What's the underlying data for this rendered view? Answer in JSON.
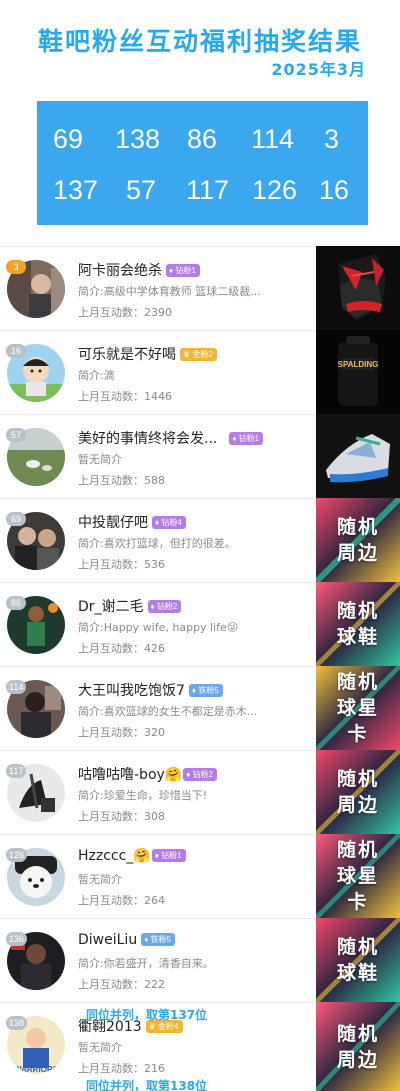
{
  "header": {
    "title": "鞋吧粉丝互动福利抽奖结果",
    "date": "2025年3月"
  },
  "winning_numbers": {
    "row1": [
      "69",
      "138",
      "86",
      "114",
      "3"
    ],
    "row2": [
      "137",
      "57",
      "117",
      "126",
      "16"
    ]
  },
  "colors": {
    "accent": "#28a9ee",
    "number_box": "#3aa7ef",
    "badge_diamond": "#b27de8",
    "badge_gold": "#f3b52f",
    "badge_iron": "#6aa7ee"
  },
  "labels": {
    "interaction_prefix": "上月互动数：",
    "bio_prefix": "简介:"
  },
  "entries": [
    {
      "rank": "3",
      "rank_style": "gold",
      "name": "阿卡丽会绝杀",
      "badge": "钻粉1",
      "badge_style": "purple",
      "badge_icon": "diamond-icon",
      "bio": "简介:高级中学体育教师 篮球二级裁...",
      "interactions": "上月互动数：2390",
      "prize": "",
      "prize_image": "red-black-sneaker"
    },
    {
      "rank": "16",
      "rank_style": "gray",
      "name": "可乐就是不好喝",
      "badge": "金粉2",
      "badge_style": "gold",
      "badge_icon": "crown-icon",
      "bio": "简介:滴",
      "interactions": "上月互动数：1446",
      "prize": "",
      "prize_image": "spalding-bag"
    },
    {
      "rank": "57",
      "rank_style": "gray",
      "name": "美好的事情终将会发...",
      "badge": "钻粉1",
      "badge_style": "purple",
      "badge_icon": "diamond-icon",
      "bio": "暂无简介",
      "interactions": "上月互动数：588",
      "prize": "",
      "prize_image": "blue-white-sneaker"
    },
    {
      "rank": "69",
      "rank_style": "gray",
      "name": "中投靓仔吧",
      "badge": "钻粉4",
      "badge_style": "purple",
      "badge_icon": "diamond-icon",
      "bio": "简介:喜欢打篮球，但打的很差。",
      "interactions": "上月互动数：536",
      "prize": "随机周边",
      "prize_image": ""
    },
    {
      "rank": "86",
      "rank_style": "gray",
      "name": "Dr_谢二毛",
      "badge": "钻粉2",
      "badge_style": "purple",
      "badge_icon": "diamond-icon",
      "bio": "简介:Happy wife, happy life😜",
      "interactions": "上月互动数：426",
      "prize": "随机球鞋",
      "prize_image": ""
    },
    {
      "rank": "114",
      "rank_style": "gray",
      "name": "大王叫我吃饱饭7",
      "badge": "铁粉5",
      "badge_style": "blue",
      "badge_icon": "diamond-icon",
      "bio": "简介:喜欢篮球的女生不都定是赤木...",
      "interactions": "上月互动数：320",
      "prize": "随机球星卡",
      "prize_image": ""
    },
    {
      "rank": "117",
      "rank_style": "gray",
      "name": "咕噜咕噜-boy",
      "name_emoji": "🤗",
      "badge": "钻粉2",
      "badge_style": "purple",
      "badge_icon": "diamond-icon",
      "bio": "简介:珍爱生命，珍惜当下!",
      "interactions": "上月互动数：308",
      "prize": "随机周边",
      "prize_image": ""
    },
    {
      "rank": "126",
      "rank_style": "gray",
      "name": "Hzzccc_",
      "name_emoji": "🤗",
      "badge": "钻粉1",
      "badge_style": "purple",
      "badge_icon": "diamond-icon",
      "bio": "暂无简介",
      "interactions": "上月互动数：264",
      "prize": "随机球星卡",
      "prize_image": ""
    },
    {
      "rank": "136",
      "rank_style": "gray",
      "name": "DiweiLiu",
      "badge": "铁粉5",
      "badge_style": "blue",
      "badge_icon": "diamond-icon",
      "bio": "简介:你若盛开，清香自来。",
      "interactions": "上月互动数：222",
      "prize": "随机球鞋",
      "prize_image": ""
    },
    {
      "rank": "138",
      "rank_style": "gray",
      "name": "衢翱2013",
      "badge": "金粉4",
      "badge_style": "gold",
      "badge_icon": "crown-icon",
      "bio": "暂无简介",
      "interactions": "上月互动数：216",
      "prize": "随机周边",
      "prize_image": ""
    }
  ],
  "notes": {
    "tie_137": "同位并列，取第137位",
    "tie_138": "同位并列，取第138位"
  }
}
